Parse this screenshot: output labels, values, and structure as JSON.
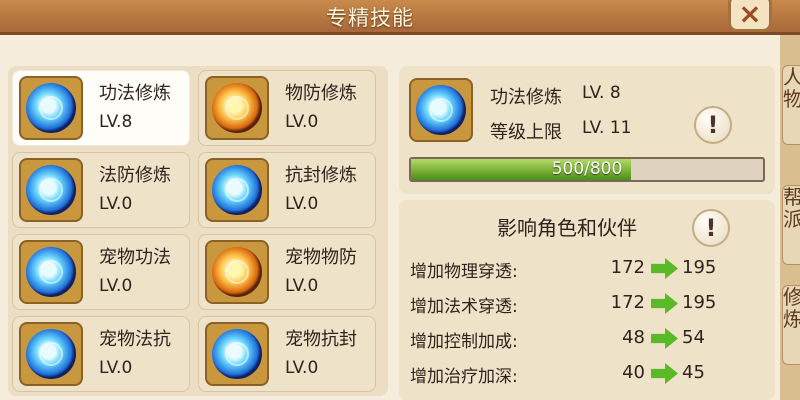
{
  "window": {
    "title": "专精技能",
    "close_icon": "close-icon"
  },
  "skills": [
    {
      "name": "功法修炼",
      "level": "LV.8",
      "icon": "blue-rune-icon"
    },
    {
      "name": "物防修炼",
      "level": "LV.0",
      "icon": "orange-armor-icon"
    },
    {
      "name": "法防修炼",
      "level": "LV.0",
      "icon": "blue-shield-icon"
    },
    {
      "name": "抗封修炼",
      "level": "LV.0",
      "icon": "blue-seal-icon"
    },
    {
      "name": "宠物功法",
      "level": "LV.0",
      "icon": "pet-magic-icon"
    },
    {
      "name": "宠物物防",
      "level": "LV.0",
      "icon": "pet-defense-icon"
    },
    {
      "name": "宠物法抗",
      "level": "LV.0",
      "icon": "pet-resist-icon"
    },
    {
      "name": "宠物抗封",
      "level": "LV.0",
      "icon": "pet-seal-icon"
    }
  ],
  "detail": {
    "name": "功法修炼",
    "level": "LV. 8",
    "cap_label": "等级上限",
    "cap_value": "LV. 11",
    "progress_text": "500/800",
    "progress_fraction": 0.625,
    "info_icon": "exclamation-icon"
  },
  "effects": {
    "title": "影响角色和伙伴",
    "rows": [
      {
        "label": "增加物理穿透:",
        "before": "172",
        "after": "195"
      },
      {
        "label": "增加法术穿透:",
        "before": "172",
        "after": "195"
      },
      {
        "label": "增加控制加成:",
        "before": "48",
        "after": "54"
      },
      {
        "label": "增加治疗加深:",
        "before": "40",
        "after": "45"
      }
    ]
  },
  "side_tabs": [
    {
      "label": "人物"
    },
    {
      "label": "帮派"
    },
    {
      "label": "修炼"
    }
  ],
  "colors": {
    "accent_green": "#59b927",
    "panel_beige": "#eee2c9",
    "title_bar_brown": "#a8683a"
  }
}
